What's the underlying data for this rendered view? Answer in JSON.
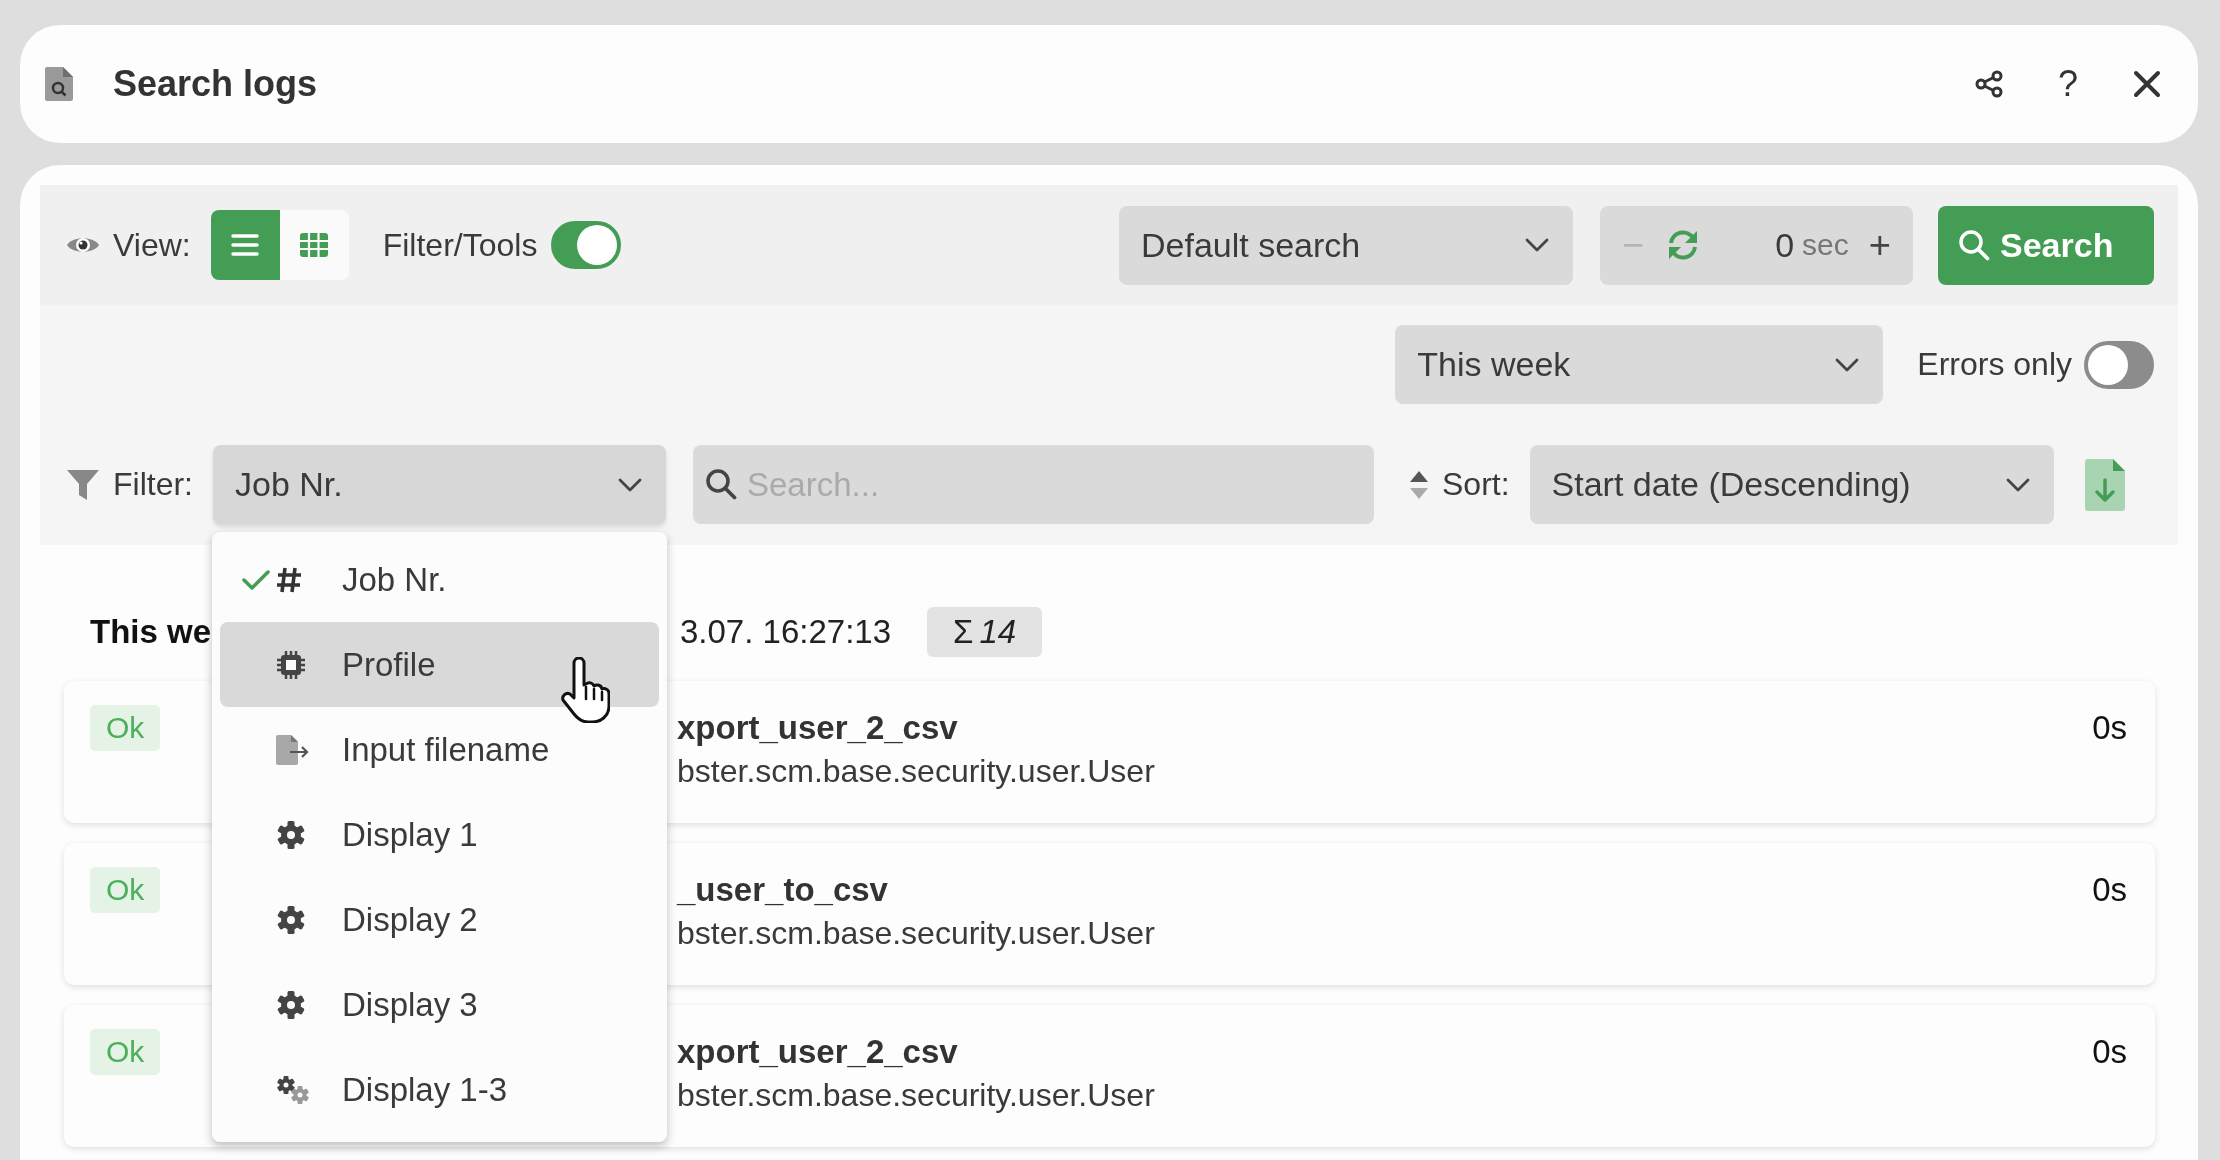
{
  "header": {
    "title": "Search logs",
    "actions": [
      {
        "kind": "share"
      },
      {
        "kind": "help",
        "label": "?"
      },
      {
        "kind": "close"
      }
    ]
  },
  "toolbar": {
    "view_label": "View:",
    "view_modes": [
      {
        "kind": "list",
        "selected": true
      },
      {
        "kind": "grid",
        "selected": false
      }
    ],
    "filter_tools": {
      "label": "Filter/Tools",
      "on": true
    },
    "saved_search": {
      "value": "Default search"
    },
    "refresh": {
      "minus": "−",
      "minus_disabled": true,
      "value": "0",
      "unit": "sec",
      "plus": "+"
    },
    "search_button": "Search"
  },
  "period": {
    "value": "This week"
  },
  "errors_only": {
    "label": "Errors only",
    "on": false
  },
  "filter": {
    "label": "Filter:",
    "value": "Job Nr.",
    "expanded": true,
    "placeholder": "Search..."
  },
  "sort": {
    "label": "Sort:",
    "value": "Start date (Descending)"
  },
  "filter_menu": [
    {
      "kind": "hash",
      "label": "Job Nr.",
      "checked": true,
      "selected": false
    },
    {
      "kind": "chip",
      "label": "Profile",
      "checked": false,
      "selected": true
    },
    {
      "kind": "file",
      "label": "Input filename",
      "checked": false,
      "selected": false
    },
    {
      "kind": "gear",
      "label": "Display 1",
      "checked": false,
      "selected": false
    },
    {
      "kind": "gear",
      "label": "Display 2",
      "checked": false,
      "selected": false
    },
    {
      "kind": "gear",
      "label": "Display 3",
      "checked": false,
      "selected": false
    },
    {
      "kind": "gears",
      "label": "Display 1-3",
      "checked": false,
      "selected": false
    }
  ],
  "results": {
    "heading": "This we",
    "time": "3.07. 16:27:13",
    "sum_symbol": "Σ",
    "count": "14"
  },
  "rows": [
    {
      "status": "Ok",
      "name": "xport_user_2_csv",
      "class": "bster.scm.base.security.user.User",
      "duration": "0s"
    },
    {
      "status": "Ok",
      "name": "_user_to_csv",
      "class": "bster.scm.base.security.user.User",
      "duration": "0s"
    },
    {
      "status": "Ok",
      "name": "xport_user_2_csv",
      "class": "bster.scm.base.security.user.User",
      "duration": "0s"
    }
  ]
}
